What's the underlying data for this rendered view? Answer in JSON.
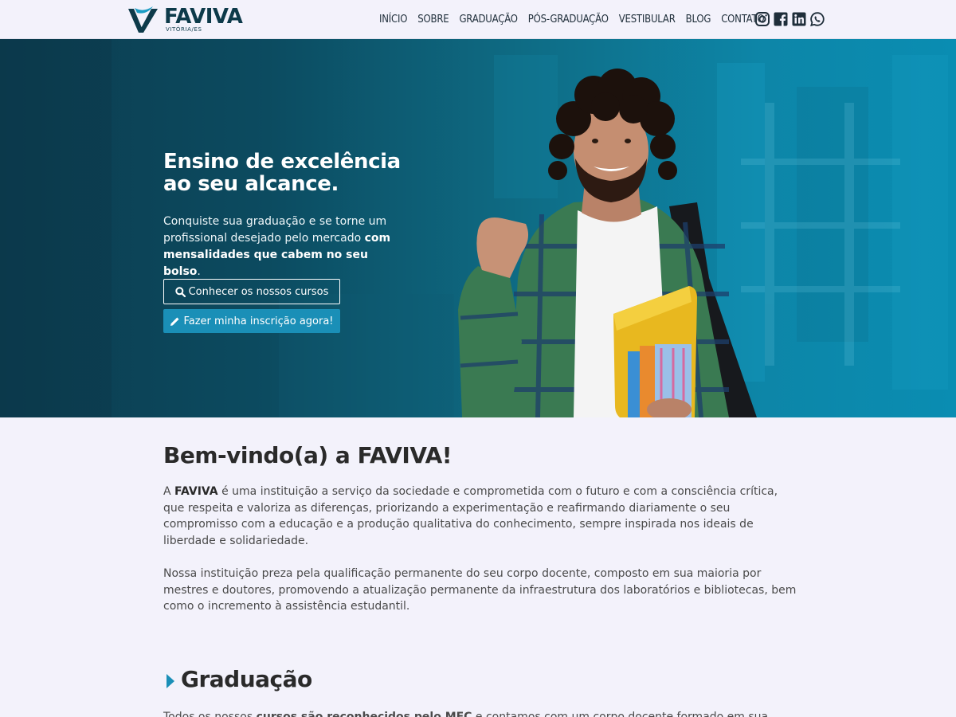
{
  "brand": {
    "name": "FAVIVA",
    "subtitle": "VITÓRIA/ES",
    "primary_color": "#0d3a4a",
    "accent_color": "#1a8fb7"
  },
  "nav": {
    "items": [
      "INÍCIO",
      "SOBRE",
      "GRADUAÇÃO",
      "PÓS-GRADUAÇÃO",
      "VESTIBULAR",
      "BLOG",
      "CONTATO"
    ],
    "social": [
      "instagram-icon",
      "facebook-icon",
      "linkedin-icon",
      "whatsapp-icon"
    ]
  },
  "hero": {
    "title_line1": "Ensino de excelência",
    "title_line2": "ao seu alcance.",
    "text_plain": "Conquiste sua graduação e se torne um profissional desejado pelo mercado ",
    "text_bold": "com mensalidades que cabem no seu bolso",
    "text_end": ".",
    "btn_courses": "Conhecer os nossos cursos",
    "btn_enroll": "Fazer minha inscrição agora!"
  },
  "welcome": {
    "title": "Bem-vindo(a) a FAVIVA!",
    "p1_start": "A ",
    "p1_bold": "FAVIVA",
    "p1_rest": " é uma instituição a serviço da sociedade e comprometida com o futuro e com a consciência crítica, que respeita e valoriza as diferenças, priorizando a experimentação e reafirmando diariamente o seu compromisso com a educação e a produção qualitativa do conhecimento, sempre inspirada nos ideais de liberdade e solidariedade.",
    "p2": "Nossa instituição preza pela qualificação permanente do seu corpo docente, composto em sua maioria por mestres e doutores, promovendo a atualização permanente da infraestrutura dos laboratórios e bibliotecas, bem como o incremento à assistência estudantil."
  },
  "graduacao": {
    "title": "Graduação",
    "p_start": "Todos os nossos ",
    "p_bold": "cursos são reconhecidos pelo MEC",
    "p_rest": " e contamos com um corpo docente formado em sua"
  }
}
